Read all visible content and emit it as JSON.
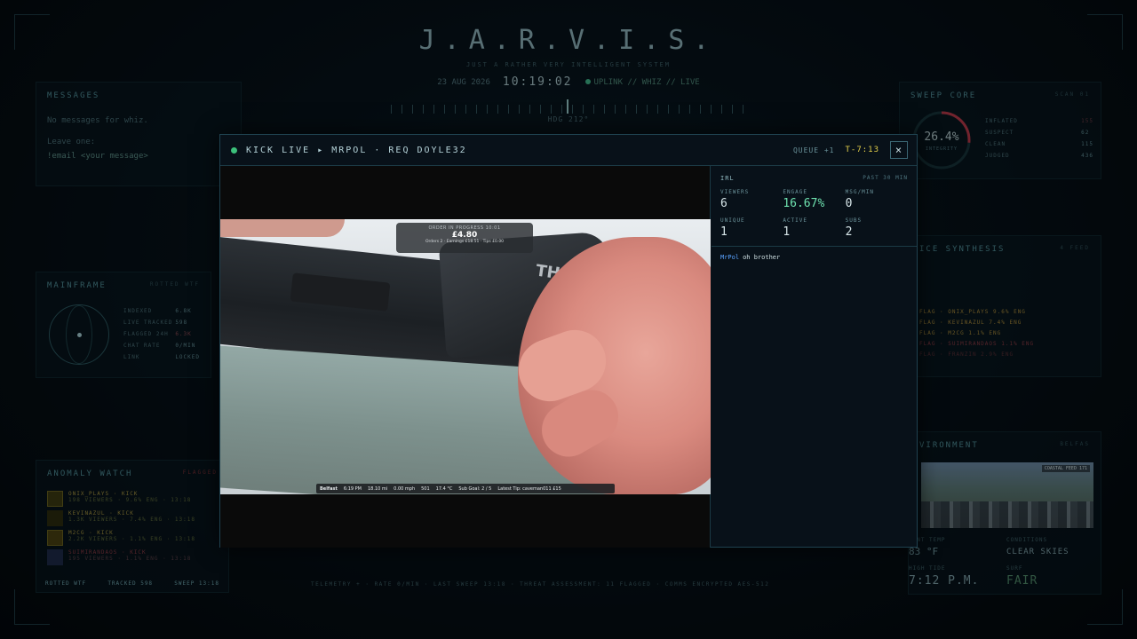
{
  "header": {
    "title": "J.A.R.V.I.S.",
    "subtitle": "JUST A RATHER VERY INTELLIGENT SYSTEM",
    "date": "23 AUG 2026",
    "time": "10:19:02",
    "uplink": "UPLINK // WHIZ // LIVE",
    "heading": "HDG 212°"
  },
  "messages": {
    "title": "MESSAGES",
    "empty": "No messages for whiz.",
    "leave": "Leave one:",
    "cmd": "!email <your message>"
  },
  "mainframe": {
    "title": "MAINFRAME",
    "tag": "ROTTED WTF",
    "rows": [
      {
        "k": "INDEXED",
        "v": "6.8K"
      },
      {
        "k": "LIVE TRACKED",
        "v": "598"
      },
      {
        "k": "FLAGGED 24H",
        "v": "6.3K"
      },
      {
        "k": "CHAT RATE",
        "v": "0/MIN"
      },
      {
        "k": "LINK",
        "v": "LOCKED"
      }
    ]
  },
  "anomaly": {
    "title": "ANOMALY WATCH",
    "tag": "FLAGGED",
    "items": [
      {
        "name": "ONIX_PLAYS",
        "platform": "KICK",
        "stats": "198 VIEWERS · 9.6% ENG · 13:18"
      },
      {
        "name": "KEVINAZUL",
        "platform": "KICK",
        "stats": "1.3K VIEWERS · 7.4% ENG · 13:18"
      },
      {
        "name": "M2CG",
        "platform": "KICK",
        "stats": "2.2K VIEWERS · 1.1% ENG · 13:18"
      },
      {
        "name": "SUIMIRANDAOS",
        "platform": "KICK",
        "stats": "195 VIEWERS · 1.1% ENG · 13:18"
      }
    ],
    "footer_left": "ROTTED WTF",
    "footer_mid": "TRACKED 598",
    "footer_right": "SWEEP 13:18"
  },
  "sweep": {
    "title": "SWEEP CORE",
    "tag": "SCAN 01",
    "percent": "26.4%",
    "percent_label": "INTEGRITY",
    "progress": 0.264,
    "rows": [
      {
        "k": "INFLATED",
        "v": "155"
      },
      {
        "k": "SUSPECT",
        "v": "62"
      },
      {
        "k": "CLEAN",
        "v": "115"
      },
      {
        "k": "JUDGED",
        "v": "436"
      }
    ]
  },
  "voice": {
    "title": "ICE SYNTHESIS",
    "tag": "4 FEED",
    "flags": [
      "FLAG · ONIX_PLAYS 9.6% ENG",
      "FLAG · KEVINAZUL 7.4% ENG",
      "FLAG · M2CG 1.1% ENG",
      "FLAG · SUIMIRANDAOS 1.1% ENG",
      "FLAG · FRANZIN 2.9% ENG"
    ]
  },
  "environment": {
    "title": "VIRONMENT",
    "tag": "BELFAS",
    "cam": "COASTAL FEED 171",
    "temp_label": "IENT TEMP",
    "temp": "83 °F",
    "cond_label": "CONDITIONS",
    "cond": "CLEAR SKIES",
    "tide_label": "HIGH TIDE",
    "tide": "7:12 P.M.",
    "surf_label": "SURF",
    "surf": "FAIR"
  },
  "telemetry": "TELEMETRY +  ·  RATE 0/MIN  ·  LAST SWEEP 13:18  ·  THREAT ASSESSMENT: 11 FLAGGED  ·  COMMS ENCRYPTED AES-512",
  "modal": {
    "title": "KICK LIVE ▸ MRPOL · REQ DOYLE32",
    "queue": "QUEUE +1",
    "timer": "T-7:13",
    "close": "×",
    "overlay": {
      "line1": "ORDER IN PROGRESS 10:01",
      "amount": "£4.80",
      "line3": "Orders 2 · Earnings £18.51 · Tips £0.00",
      "brand": "THULE"
    },
    "bottom_bar": [
      "Belfast",
      "6:19 PM",
      "18.10 mi",
      "0.00 mph",
      "501",
      "17.4 °C",
      "Sub Goal: 2 / 5",
      "Latest Tip: caveman011 £15"
    ],
    "side": {
      "category": "IRL",
      "range": "PAST 30 MIN",
      "stats": [
        {
          "label": "VIEWERS",
          "value": "6"
        },
        {
          "label": "ENGAGE",
          "value": "16.67%"
        },
        {
          "label": "MSG/MIN",
          "value": "0"
        },
        {
          "label": "UNIQUE",
          "value": "1"
        },
        {
          "label": "ACTIVE",
          "value": "1"
        },
        {
          "label": "SUBS",
          "value": "2"
        }
      ],
      "chat": [
        {
          "user": "MrPol",
          "text": "oh brother"
        }
      ]
    }
  }
}
